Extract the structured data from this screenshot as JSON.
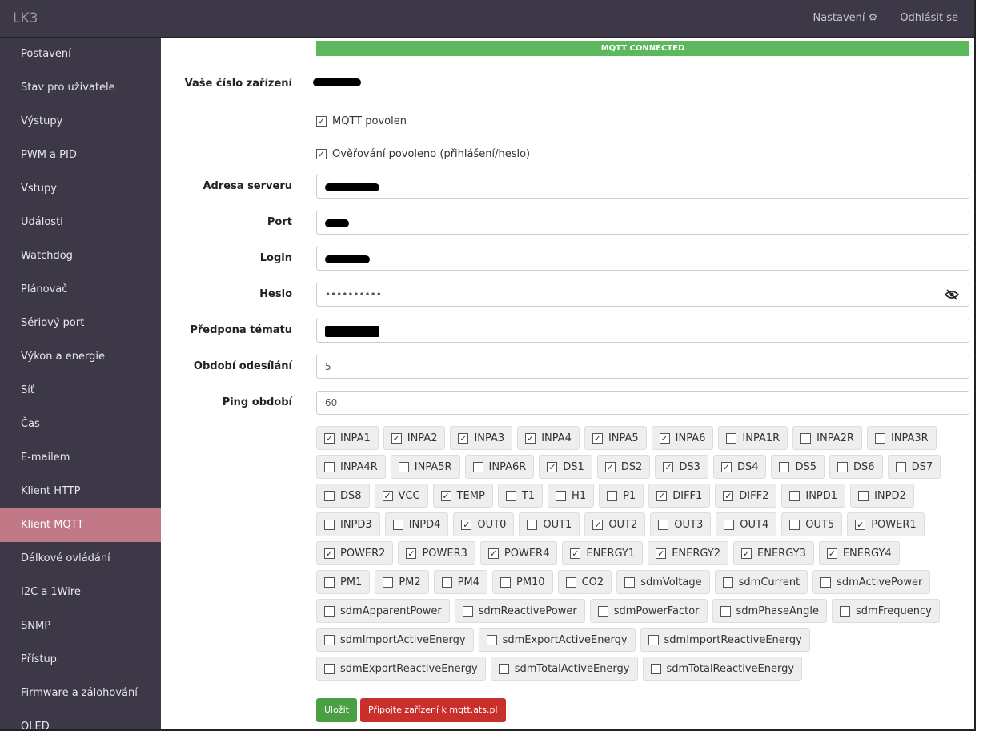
{
  "header": {
    "brand": "LK3",
    "settings": "Nastavení",
    "logout": "Odhlásit se"
  },
  "sidebar": {
    "items": [
      "Postavení",
      "Stav pro uživatele",
      "Výstupy",
      "PWM a PID",
      "Vstupy",
      "Události",
      "Watchdog",
      "Plánovač",
      "Sériový port",
      "Výkon a energie",
      "Síť",
      "Čas",
      "E-mailem",
      "Klient HTTP",
      "Klient MQTT",
      "Dálkové ovládání",
      "I2C a 1Wire",
      "SNMP",
      "Přístup",
      "Firmware a zálohování",
      "OLED"
    ],
    "active": "Klient MQTT"
  },
  "status": "MQTT CONNECTED",
  "form": {
    "device_label": "Vaše číslo zařízení",
    "mqtt_enabled": "MQTT povolen",
    "auth_enabled": "Ověřování povoleno (přihlášení/heslo)",
    "server_label": "Adresa serveru",
    "port_label": "Port",
    "login_label": "Login",
    "password_label": "Heslo",
    "password_value": "••••••••••",
    "topic_label": "Předpona tématu",
    "period_label": "Období odesílání",
    "period_value": "5",
    "ping_label": "Ping období",
    "ping_value": "60"
  },
  "channels": [
    {
      "n": "INPA1",
      "c": true
    },
    {
      "n": "INPA2",
      "c": true
    },
    {
      "n": "INPA3",
      "c": true
    },
    {
      "n": "INPA4",
      "c": true
    },
    {
      "n": "INPA5",
      "c": true
    },
    {
      "n": "INPA6",
      "c": true
    },
    {
      "n": "INPA1R",
      "c": false
    },
    {
      "n": "INPA2R",
      "c": false
    },
    {
      "n": "INPA3R",
      "c": false
    },
    {
      "n": "INPA4R",
      "c": false
    },
    {
      "n": "INPA5R",
      "c": false
    },
    {
      "n": "INPA6R",
      "c": false
    },
    {
      "n": "DS1",
      "c": true
    },
    {
      "n": "DS2",
      "c": true
    },
    {
      "n": "DS3",
      "c": true
    },
    {
      "n": "DS4",
      "c": true
    },
    {
      "n": "DS5",
      "c": false
    },
    {
      "n": "DS6",
      "c": false
    },
    {
      "n": "DS7",
      "c": false
    },
    {
      "n": "DS8",
      "c": false
    },
    {
      "n": "VCC",
      "c": true
    },
    {
      "n": "TEMP",
      "c": true
    },
    {
      "n": "T1",
      "c": false
    },
    {
      "n": "H1",
      "c": false
    },
    {
      "n": "P1",
      "c": false
    },
    {
      "n": "DIFF1",
      "c": true
    },
    {
      "n": "DIFF2",
      "c": true
    },
    {
      "n": "INPD1",
      "c": false
    },
    {
      "n": "INPD2",
      "c": false
    },
    {
      "n": "INPD3",
      "c": false
    },
    {
      "n": "INPD4",
      "c": false
    },
    {
      "n": "OUT0",
      "c": true
    },
    {
      "n": "OUT1",
      "c": false
    },
    {
      "n": "OUT2",
      "c": true
    },
    {
      "n": "OUT3",
      "c": false
    },
    {
      "n": "OUT4",
      "c": false
    },
    {
      "n": "OUT5",
      "c": false
    },
    {
      "n": "POWER1",
      "c": true
    },
    {
      "n": "POWER2",
      "c": true
    },
    {
      "n": "POWER3",
      "c": true
    },
    {
      "n": "POWER4",
      "c": true
    },
    {
      "n": "ENERGY1",
      "c": true
    },
    {
      "n": "ENERGY2",
      "c": true
    },
    {
      "n": "ENERGY3",
      "c": true
    },
    {
      "n": "ENERGY4",
      "c": true
    },
    {
      "n": "PM1",
      "c": false
    },
    {
      "n": "PM2",
      "c": false
    },
    {
      "n": "PM4",
      "c": false
    },
    {
      "n": "PM10",
      "c": false
    },
    {
      "n": "CO2",
      "c": false
    },
    {
      "n": "sdmVoltage",
      "c": false
    },
    {
      "n": "sdmCurrent",
      "c": false
    },
    {
      "n": "sdmActivePower",
      "c": false
    },
    {
      "n": "sdmApparentPower",
      "c": false
    },
    {
      "n": "sdmReactivePower",
      "c": false
    },
    {
      "n": "sdmPowerFactor",
      "c": false
    },
    {
      "n": "sdmPhaseAngle",
      "c": false
    },
    {
      "n": "sdmFrequency",
      "c": false
    },
    {
      "n": "sdmImportActiveEnergy",
      "c": false
    },
    {
      "n": "sdmExportActiveEnergy",
      "c": false
    },
    {
      "n": "sdmImportReactiveEnergy",
      "c": false
    },
    {
      "n": "sdmExportReactiveEnergy",
      "c": false
    },
    {
      "n": "sdmTotalActiveEnergy",
      "c": false
    },
    {
      "n": "sdmTotalReactiveEnergy",
      "c": false
    }
  ],
  "buttons": {
    "save": "Uložit",
    "connect": "Připojte zařízení k mqtt.ats.pl"
  },
  "colors": {
    "navbar": "#3d3847",
    "active": "#c07886",
    "success": "#5cb85c",
    "danger": "#c9302c"
  }
}
